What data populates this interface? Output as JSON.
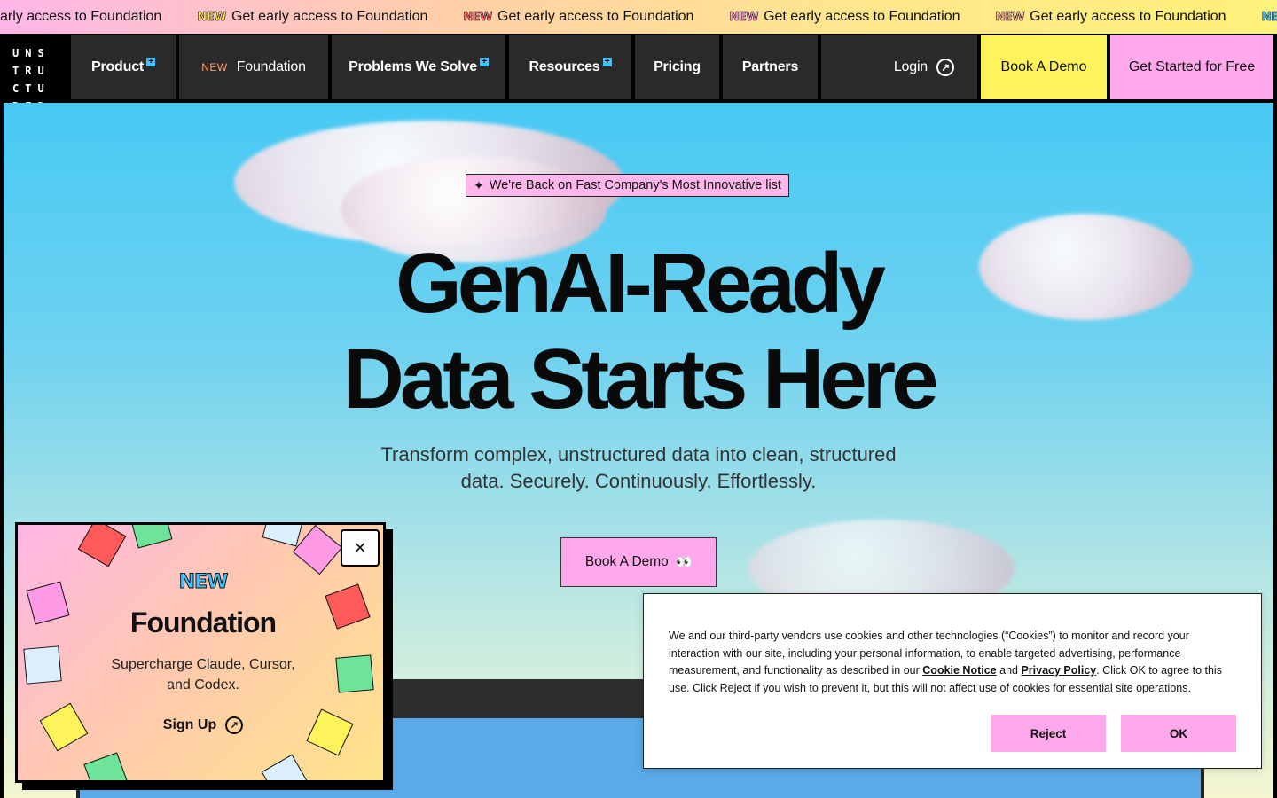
{
  "ticker": {
    "new_tag": "NEW",
    "text": "Get early access to Foundation",
    "first_partial": "arly access to Foundation",
    "tag_colors": [
      "#ffe85c",
      "#ff6b6b",
      "#ff9bd6",
      "#ffb3a0",
      "#3dc3ff"
    ]
  },
  "nav": {
    "logo": "UNSTRUCTURED",
    "product": "Product",
    "new_label": "NEW",
    "foundation": "Foundation",
    "problems": "Problems We Solve",
    "resources": "Resources",
    "pricing": "Pricing",
    "partners": "Partners",
    "login": "Login",
    "book_demo": "Book A Demo",
    "get_started": "Get Started for Free",
    "colors": {
      "book_demo_bg": "#fff35c",
      "get_started_bg": "#ffa8ec",
      "item_bg": "#2a2a2a"
    }
  },
  "hero": {
    "badge": "We're Back on Fast Company's Most Innovative list",
    "headline_line1": "GenAI-Ready",
    "headline_line2": "Data Starts Here",
    "subhead_line1": "Transform complex, unstructured data into clean, structured",
    "subhead_line2": "data. Securely. Continuously. Effortlessly.",
    "cta": "Book A Demo",
    "cta_eyes": "👀"
  },
  "promo": {
    "new_label": "NEW",
    "title": "Foundation",
    "subtitle": "Supercharge Claude, Cursor, and Codex.",
    "signup": "Sign Up",
    "close": "✕"
  },
  "cookie": {
    "text_before": "We and our third-party vendors use cookies and other technologies (“Cookies”) to monitor and record your interaction with our site, including your personal information, to enable targeted advertising, performance measurement, and functionality as described in our ",
    "cookie_notice": "Cookie Notice",
    "and": " and ",
    "privacy_policy": "Privacy Policy",
    "text_after": ". Click OK to agree to this use. Click Reject if you wish to prevent it, but this will not affect use of cookies for essential site operations.",
    "reject": "Reject",
    "ok": "OK"
  }
}
